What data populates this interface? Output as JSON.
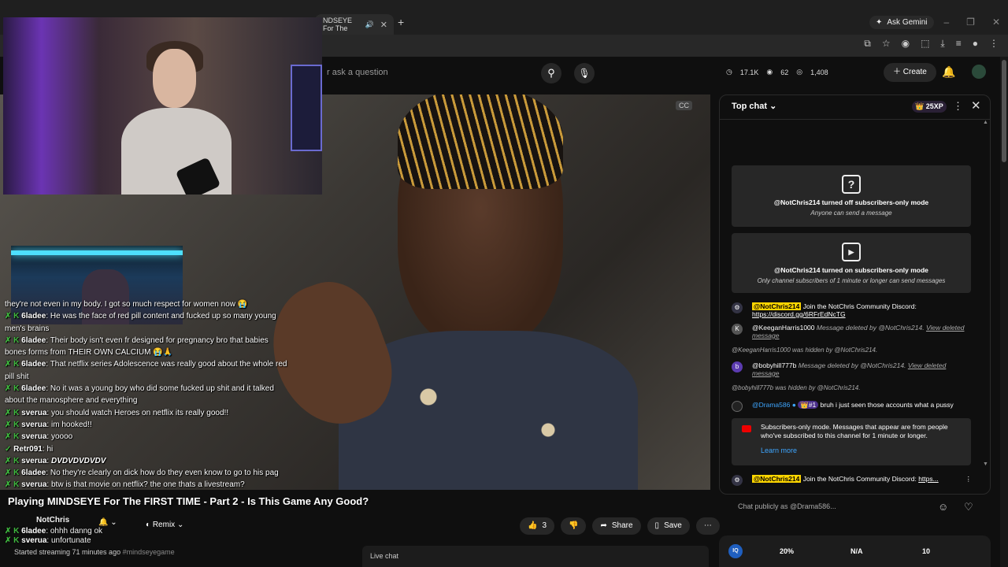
{
  "browser": {
    "tab_title": "NDSEYE For The",
    "new_tab": "+",
    "gemini_label": "Ask Gemini",
    "window_controls": [
      "–",
      "❐",
      "✕"
    ]
  },
  "header": {
    "search_placeholder": "r ask a question",
    "stats": {
      "views": "17.1K",
      "watching": "62",
      "likes": "1,408"
    },
    "create_label": "Create"
  },
  "video": {
    "title": "Playing MINDSEYE For The FIRST TIME - Part 2 - Is This Game Any Good?",
    "channel": "NotChris",
    "remix_label": "Remix",
    "like_count": "3",
    "share_label": "Share",
    "save_label": "Save",
    "streaming_status": "Started streaming 71 minutes ago",
    "streaming_tag": "#mindseyegame",
    "livechat_tab": "Live chat"
  },
  "overlay_chat": [
    {
      "user": "",
      "text": "they're not even in my body. I got so much respect for women now 😭"
    },
    {
      "user": "6ladee",
      "text": "He was the face of red pill content and fucked up so many young men's brains"
    },
    {
      "user": "6ladee",
      "text": "Their body isn't even fr designed for pregnancy bro that babies bones forms from THEIR OWN CALCIUM 😭🙏"
    },
    {
      "user": "6ladee",
      "text": "That netflix series Adolescence was really good about the whole red pill shit"
    },
    {
      "user": "6ladee",
      "text": "No it was a young boy who did some fucked up shit and it talked about the manosphere and everything"
    },
    {
      "user": "sverua",
      "text": "you should watch Heroes on netflix its really good!!"
    },
    {
      "user": "sverua",
      "text": "im hooked!!"
    },
    {
      "user": "sverua",
      "text": "yoooo"
    },
    {
      "user": "Retr091",
      "text": "hi"
    },
    {
      "user": "sverua",
      "text": "DVDVDVDVDV"
    },
    {
      "user": "6ladee",
      "text": "No they're clearly on dick how do they even know to go to his pag"
    },
    {
      "user": "sverua",
      "text": "btw is that movie on netflix? the one thats a livestream?"
    },
    {
      "user": "6ladee",
      "text": "ohhh danng ok"
    },
    {
      "user": "sverua",
      "text": "unfortunate"
    },
    {
      "user": "Drama586",
      "text": ""
    }
  ],
  "chat": {
    "header": "Top chat",
    "xp": "25XP",
    "card1": {
      "title": "@NotChris214 turned off subscribers-only mode",
      "subtitle": "Anyone can send a message"
    },
    "card2": {
      "title": "@NotChris214 turned on subscribers-only mode",
      "subtitle": "Only channel subscribers of 1 minute or longer can send messages"
    },
    "msg1": {
      "user": "@NotChris214",
      "text": "Join the NotChris Community Discord:",
      "url": "https://discord.gg/6RFrEdNcTG"
    },
    "msg2": {
      "avatar": "K",
      "user": "@KeeganHarris1000",
      "text": "Message deleted by @NotChris214.",
      "link": "View deleted message"
    },
    "hidden1": "@KeeganHarris1000 was hidden by @NotChris214.",
    "msg3": {
      "avatar": "b",
      "user": "@bobyhill777b",
      "text": "Message deleted by @NotChris214.",
      "link": "View deleted message"
    },
    "hidden2": "@bobyhill777b was hidden by @NotChris214.",
    "msg4": {
      "user": "@Drama586",
      "badge": "#1",
      "text": "bruh i just seen those accounts what a pussy"
    },
    "subs_notice": "Subscribers-only mode. Messages that appear are from people who've subscribed to this channel for 1 minute or longer.",
    "learn_more": "Learn more",
    "pinned": {
      "user": "@NotChris214",
      "text": "Join the NotChris Community Discord:",
      "url": "https..."
    },
    "input_placeholder": "Chat publicly as @Drama586...",
    "bottom": {
      "logo": "IQ",
      "v1": "20%",
      "v2": "N/A",
      "v3": "10"
    }
  }
}
